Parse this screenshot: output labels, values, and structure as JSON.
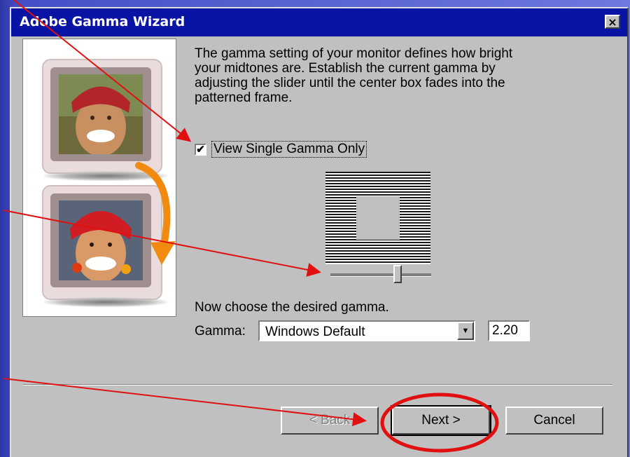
{
  "window": {
    "title": "Adobe Gamma Wizard",
    "close_label": "×"
  },
  "content": {
    "description": "The gamma setting of your monitor defines how bright your midtones are. Establish the current gamma by adjusting the slider until the center box fades into the patterned frame.",
    "checkbox_label": "View Single Gamma Only",
    "checkbox_checked": true,
    "checkbox_mark": "✔",
    "choose_label": "Now choose the desired gamma.",
    "gamma_label": "Gamma:",
    "gamma_select_value": "Windows Default",
    "gamma_select_arrow": "▼",
    "gamma_value": "2.20",
    "slider_value": 0.68
  },
  "buttons": {
    "back": "< Back",
    "next": "Next >",
    "cancel": "Cancel"
  },
  "colors": {
    "titlebar": "#0a14a4",
    "annotation": "#e01010"
  },
  "icons": {
    "close": "close-icon",
    "dropdown": "chevron-down-icon"
  }
}
